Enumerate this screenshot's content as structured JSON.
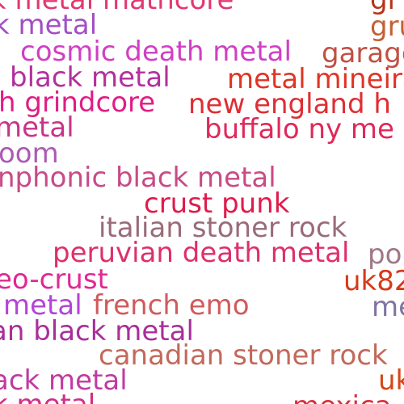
{
  "tags": [
    {
      "text": "k metal mathcore",
      "color": "#e2386f"
    },
    {
      "text": "gr",
      "color": "#b6341a"
    },
    {
      "text": "k metal",
      "color": "#a24fc4"
    },
    {
      "text": "gru",
      "color": "#c46034"
    },
    {
      "text": "cosmic death metal",
      "color": "#d03fc4"
    },
    {
      "text": "garage",
      "color": "#c25043"
    },
    {
      "text": "black metal",
      "color": "#b2309c"
    },
    {
      "text": "metal mineira",
      "color": "#df3525"
    },
    {
      "text": "h grindcore",
      "color": "#e01d84"
    },
    {
      "text": "new england h",
      "color": "#df2e33"
    },
    {
      "text": "metal",
      "color": "#c73489"
    },
    {
      "text": "buffalo ny me",
      "color": "#e0285a"
    },
    {
      "text": "oom",
      "color": "#ac5ab5"
    },
    {
      "text": "nphonic black metal",
      "color": "#c84b86"
    },
    {
      "text": "crust punk",
      "color": "#e01b4c"
    },
    {
      "text": "italian stoner rock",
      "color": "#9a6b79"
    },
    {
      "text": "peruvian death metal",
      "color": "#de2f6c"
    },
    {
      "text": "po",
      "color": "#a07885"
    },
    {
      "text": "eo-crust",
      "color": "#e02896"
    },
    {
      "text": "uk82",
      "color": "#d63a1a"
    },
    {
      "text": "metal",
      "color": "#b245d6"
    },
    {
      "text": "french emo",
      "color": "#d15a5c"
    },
    {
      "text": "me",
      "color": "#8174a2"
    },
    {
      "text": "an black metal",
      "color": "#a82f9a"
    },
    {
      "text": "canadian stoner rock",
      "color": "#c2695b"
    },
    {
      "text": "ack metal",
      "color": "#c13aa2"
    },
    {
      "text": "uk",
      "color": "#d64615"
    },
    {
      "text": "k metal",
      "color": "#d02e88"
    },
    {
      "text": "mexica",
      "color": "#d92f3d"
    }
  ]
}
